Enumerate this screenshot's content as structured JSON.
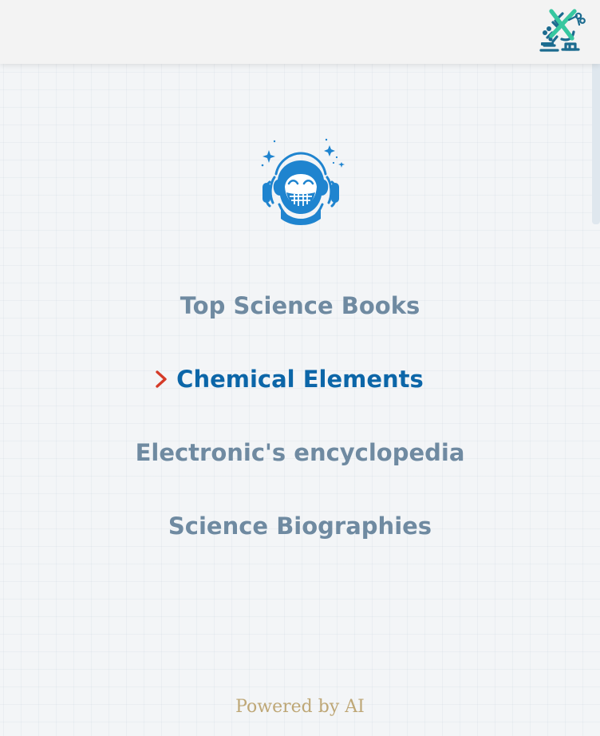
{
  "header": {
    "logo_icon": "microscope-x-icon",
    "logo_colors": {
      "primary": "#1c6b8f",
      "accent": "#37c7a0"
    }
  },
  "hero": {
    "icon": "astronaut-monkey-icon",
    "color": "#1f84cf"
  },
  "menu": {
    "items": [
      {
        "label": "Top Science Books",
        "active": false
      },
      {
        "label": "Chemical Elements",
        "active": true
      },
      {
        "label": "Electronic's encyclopedia",
        "active": false
      },
      {
        "label": "Science Biographies",
        "active": false
      }
    ],
    "active_indicator": "chevron-right-icon",
    "indicator_color": "#d53b28",
    "label_color": "#6f8aa1",
    "active_label_color": "#0c66a8"
  },
  "footer": {
    "text": "Powered by AI",
    "color": "#bea776"
  }
}
